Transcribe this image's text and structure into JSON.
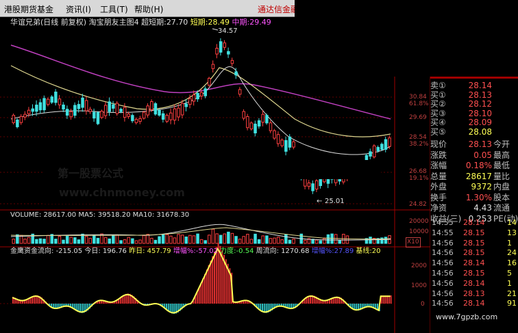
{
  "menu": {
    "items": [
      "港股期货基金",
      "资讯(I)",
      "工具(T)",
      "帮助(H)"
    ],
    "right_title": "通达信金融"
  },
  "main_header": {
    "stock": "华谊兄弟(日线 前复权)",
    "indicator": "淘宝朋友主图4",
    "super_short_label": "超短期:",
    "super_short_value": "27.70",
    "short_label": "短期:",
    "short_value": "28.49",
    "mid_label": "中期:",
    "mid_value": "29.49"
  },
  "annotations": {
    "high": "34.57",
    "low": "25.01"
  },
  "price_axis": {
    "labels": [
      "30.84",
      "61.8%",
      "29.69",
      "28.54",
      "38.2%",
      "26.68",
      "19.1%",
      "24.82"
    ]
  },
  "watermark": {
    "line1": "第一股票公式",
    "line2": "www.chnmoney.com"
  },
  "volume_header": {
    "vol_label": "VOLUME:",
    "vol_value": "28617.00",
    "ma5_label": "MA5:",
    "ma5_value": "39518.20",
    "ma10_label": "MA10:",
    "ma10_value": "31678.30"
  },
  "volume_axis": {
    "labels": [
      "20000",
      "10000",
      "X10"
    ]
  },
  "flow_header": {
    "title": "金鹰资金流向:",
    "title_value": "-215.05",
    "today_label": "今日:",
    "today_value": "196.76",
    "yesterday_label": "昨日:",
    "yesterday_value": "457.79",
    "amp_label": "增幅%:",
    "amp_value": "-57.02",
    "force_label": "力度:",
    "force_value": "-0.54",
    "week_label": "周流向:",
    "week_value": "1270.68",
    "amp2_label": "增幅%:",
    "amp2_value": "27.89",
    "base_label": "基线:",
    "base_value": "20"
  },
  "flow_axis": {
    "labels": [
      "2000",
      "1000",
      "0"
    ]
  },
  "quotes": [
    {
      "label": "卖①",
      "value": "28.14",
      "right": ""
    },
    {
      "label": "买①",
      "value": "28.13",
      "right": ""
    },
    {
      "label": "买②",
      "value": "28.12",
      "right": ""
    },
    {
      "label": "买③",
      "value": "28.10",
      "right": ""
    },
    {
      "label": "买④",
      "value": "28.09",
      "right": ""
    },
    {
      "label": "买⑤",
      "value": "28.08",
      "right": ""
    }
  ],
  "stats": [
    {
      "label": "现价",
      "value": "28.13",
      "right": "今开"
    },
    {
      "label": "涨跌",
      "value": "0.05",
      "right": "最高"
    },
    {
      "label": "涨幅",
      "value": "0.18%",
      "right": "最低"
    },
    {
      "label": "总量",
      "value": "28617",
      "right": "量比"
    },
    {
      "label": "外盘",
      "value": "9372",
      "right": "内盘"
    },
    {
      "label": "换手",
      "value": "1.30%",
      "right": "股本"
    },
    {
      "label": "净资",
      "value": "4.43",
      "right": "流通"
    },
    {
      "label": "收益(三)",
      "value": "0.253",
      "right": "PE(动)"
    }
  ],
  "ticks": [
    {
      "time": "14:55",
      "price": "28.14",
      "vol": "14"
    },
    {
      "time": "14:55",
      "price": "28.15",
      "vol": "13"
    },
    {
      "time": "14:56",
      "price": "28.15",
      "vol": "1"
    },
    {
      "time": "14:56",
      "price": "28.15",
      "vol": "24"
    },
    {
      "time": "14:56",
      "price": "28.14",
      "vol": "16"
    },
    {
      "time": "14:56",
      "price": "28.15",
      "vol": "5"
    },
    {
      "time": "14:56",
      "price": "28.14",
      "vol": "1"
    },
    {
      "time": "14:56",
      "price": "28.13",
      "vol": "21"
    },
    {
      "time": "14:56",
      "price": "28.14",
      "vol": "91"
    }
  ],
  "footer_watermark": "www.7gpzb.com"
}
